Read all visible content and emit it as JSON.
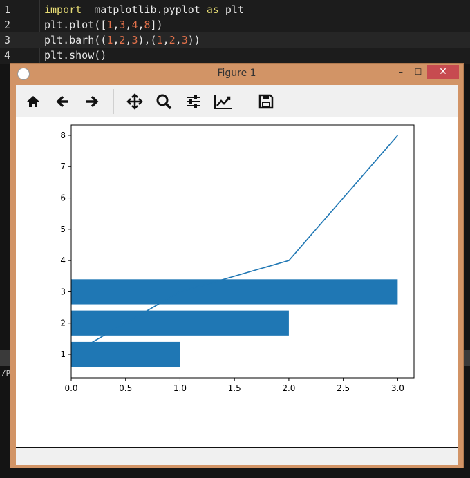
{
  "editor": {
    "lines": [
      {
        "n": "1",
        "parts": [
          [
            "kw",
            "import"
          ],
          [
            "",
            "  matplotlib.pyplot "
          ],
          [
            "kw",
            "as"
          ],
          [
            "",
            " plt"
          ]
        ]
      },
      {
        "n": "2",
        "parts": [
          [
            "",
            "plt.plot(["
          ],
          [
            "num",
            "1"
          ],
          [
            "",
            ","
          ],
          [
            "num",
            "3"
          ],
          [
            "",
            ","
          ],
          [
            "num",
            "4"
          ],
          [
            "",
            ","
          ],
          [
            "num",
            "8"
          ],
          [
            "",
            "])"
          ]
        ]
      },
      {
        "n": "3",
        "parts": [
          [
            "",
            "plt.barh(("
          ],
          [
            "num",
            "1"
          ],
          [
            "",
            ","
          ],
          [
            "num",
            "2"
          ],
          [
            "",
            ","
          ],
          [
            "num",
            "3"
          ],
          [
            "",
            "),("
          ],
          [
            "num",
            "1"
          ],
          [
            "",
            ","
          ],
          [
            "num",
            "2"
          ],
          [
            "",
            ","
          ],
          [
            "num",
            "3"
          ],
          [
            "",
            "))"
          ]
        ]
      },
      {
        "n": "4",
        "parts": [
          [
            "",
            "plt.show()"
          ]
        ]
      }
    ],
    "console_text": "/P"
  },
  "window": {
    "title": "Figure 1",
    "minimize": "–",
    "maximize": "☐",
    "close": "✕"
  },
  "toolbar": [
    "home-icon",
    "back-icon",
    "forward-icon",
    "pan-icon",
    "zoom-icon",
    "configure-subplots-icon",
    "edit-axis-icon",
    "save-icon"
  ],
  "chart_data": {
    "type": "bar+line",
    "bars": {
      "orientation": "horizontal",
      "y": [
        1,
        2,
        3
      ],
      "width": [
        1,
        2,
        3
      ],
      "height": 0.8,
      "color": "#1f77b4"
    },
    "line": {
      "x": [
        0,
        1,
        2,
        3
      ],
      "y": [
        1,
        3,
        4,
        8
      ],
      "color": "#1f77b4"
    },
    "xlim": [
      0,
      3.15
    ],
    "ylim": [
      0.25,
      8.33
    ],
    "xticks": [
      "0.0",
      "0.5",
      "1.0",
      "1.5",
      "2.0",
      "2.5",
      "3.0"
    ],
    "yticks": [
      "1",
      "2",
      "3",
      "4",
      "5",
      "6",
      "7",
      "8"
    ]
  }
}
